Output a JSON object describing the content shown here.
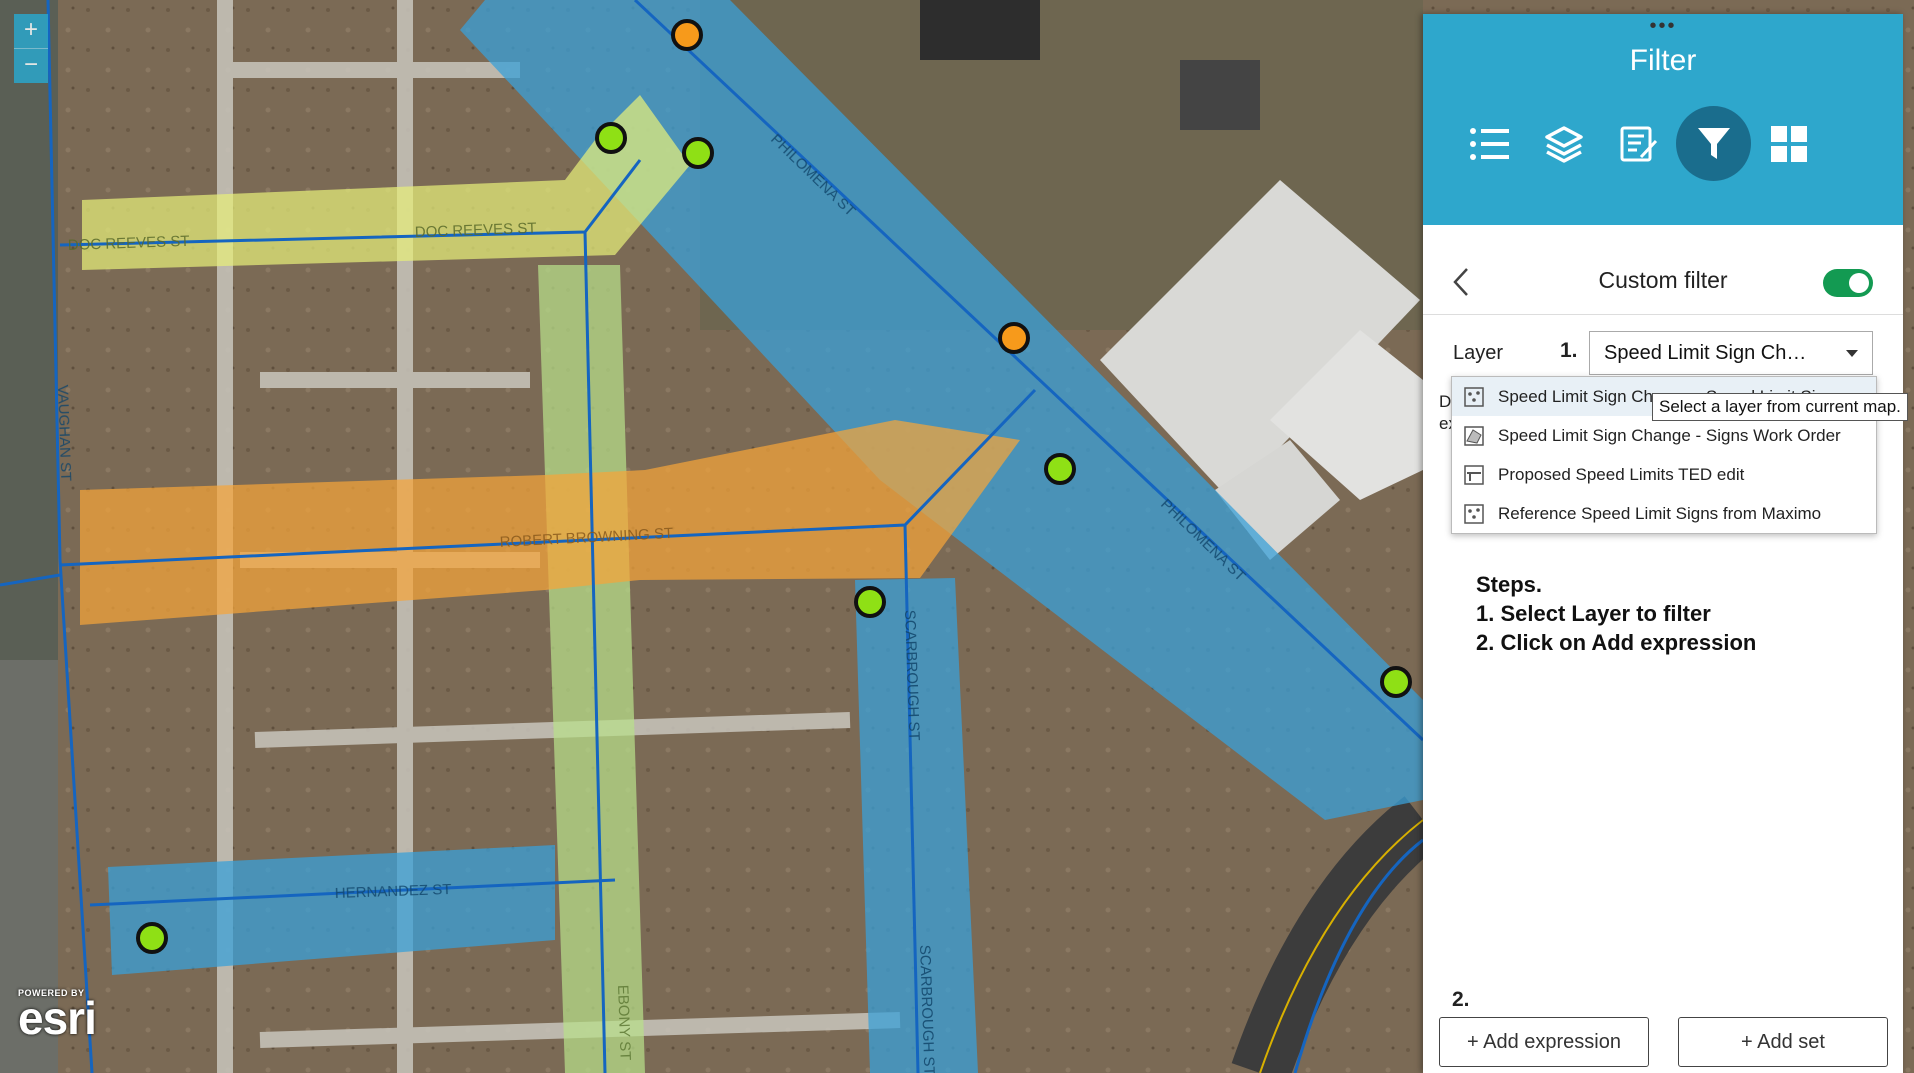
{
  "map": {
    "zoom_in": "+",
    "zoom_out": "−",
    "streets": {
      "doc_reeves_1": "DOC REEVES ST",
      "doc_reeves_2": "DOC REEVES ST",
      "philomena_1": "PHILOMENA ST",
      "philomena_2": "PHILOMENA ST",
      "vaughan": "VAUGHAN ST",
      "robert_browning": "ROBERT BROWNING ST",
      "scarbrough_1": "SCARBROUGH ST",
      "scarbrough_2": "SCARBROUGH ST",
      "hernandez": "HERNANDEZ ST",
      "ebony": "EBONY ST"
    },
    "colors": {
      "blue_zone": "#3aa0d8",
      "yellow_zone": "#e6ef7a",
      "green_zone": "#b9e08a",
      "orange_zone": "#f5a53a",
      "green_point": "#8fe015",
      "orange_point": "#f79a1b",
      "road_line": "#1565c0"
    },
    "attribution": {
      "powered": "POWERED BY",
      "logo": "esri"
    }
  },
  "panel": {
    "dots": "•••",
    "title": "Filter",
    "tools": [
      {
        "name": "legend-icon"
      },
      {
        "name": "layers-icon"
      },
      {
        "name": "edit-icon"
      },
      {
        "name": "filter-icon",
        "active": true
      },
      {
        "name": "grid-icon"
      }
    ],
    "custom_filter": {
      "title": "Custom filter",
      "enabled": true
    },
    "layer": {
      "label": "Layer",
      "step": "1.",
      "selected": "Speed Limit Sign Ch…",
      "options": [
        "Speed Limit Sign Change - Speed Limit Sign",
        "Speed Limit Sign Change - Signs Work Order",
        "Proposed Speed Limits TED edit",
        "Reference Speed Limit Signs from Maximo"
      ],
      "tooltip": "Select a layer from current map."
    },
    "ghost": {
      "d": "D",
      "ex": "ex"
    },
    "steps": {
      "title": "Steps.",
      "line1": "1. Select Layer to filter",
      "line2": "2. Click on Add expression"
    },
    "step2": "2.",
    "add_expression": "+ Add expression",
    "add_set": "+ Add set",
    "accent": "#2ea7cc",
    "toggle_color": "#139a52"
  }
}
